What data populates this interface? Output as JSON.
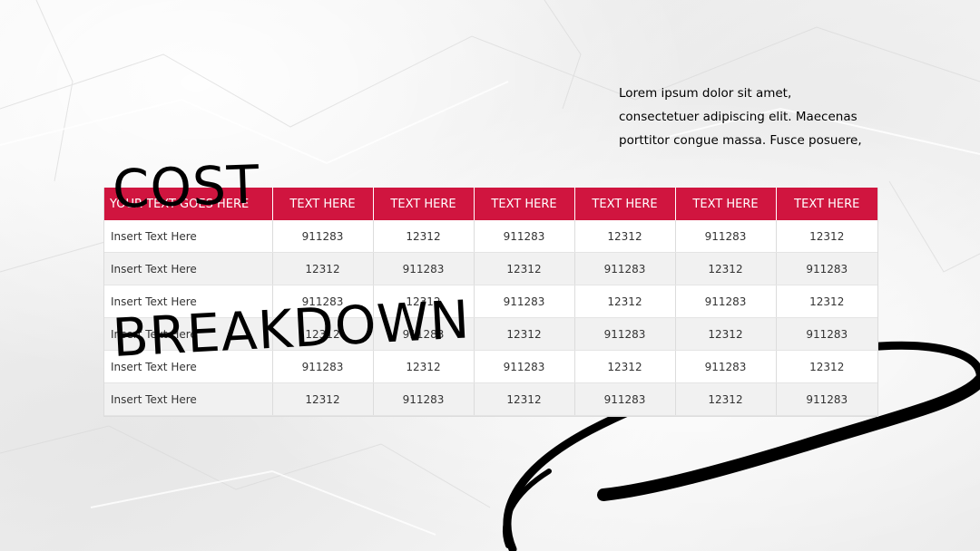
{
  "slide": {
    "title_line1": "COST",
    "title_line2": "BREAKDOWN",
    "description": "Lorem ipsum dolor sit amet, consectetuer adipiscing elit. Maecenas porttitor congue massa. Fusce posuere,"
  },
  "table": {
    "headers": [
      "YOUR TEXT GOES HERE",
      "TEXT HERE",
      "TEXT HERE",
      "TEXT HERE",
      "TEXT HERE",
      "TEXT HERE",
      "TEXT HERE"
    ],
    "rows": [
      [
        "Insert Text Here",
        "911283",
        "12312",
        "911283",
        "12312",
        "911283",
        "12312"
      ],
      [
        "Insert Text Here",
        "12312",
        "911283",
        "12312",
        "911283",
        "12312",
        "911283"
      ],
      [
        "Insert Text Here",
        "911283",
        "12312",
        "911283",
        "12312",
        "911283",
        "12312"
      ],
      [
        "Insert Text Here",
        "12312",
        "911283",
        "12312",
        "911283",
        "12312",
        "911283"
      ],
      [
        "Insert Text Here",
        "911283",
        "12312",
        "911283",
        "12312",
        "911283",
        "12312"
      ],
      [
        "Insert Text Here",
        "12312",
        "911283",
        "12312",
        "911283",
        "12312",
        "911283"
      ]
    ]
  },
  "colors": {
    "header_bg": "#d0153f",
    "header_text": "#ffffff",
    "row_alt": "#f1f1f1",
    "swoosh": "#000000"
  },
  "decor": {
    "background": "crumpled-paper-texture",
    "swoosh": "brush-stroke-loop"
  }
}
